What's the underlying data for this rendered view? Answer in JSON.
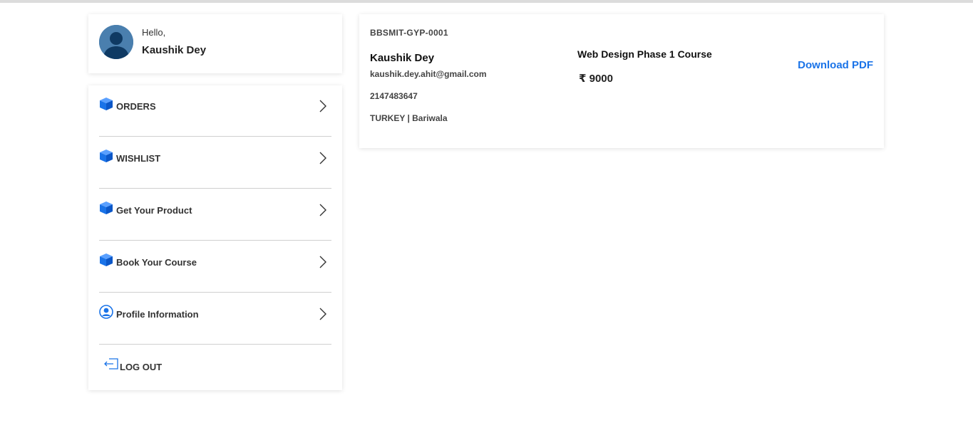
{
  "profile": {
    "greeting": "Hello,",
    "name": "Kaushik Dey"
  },
  "menu": {
    "items": [
      {
        "label": "ORDERS",
        "icon": "box-icon"
      },
      {
        "label": "WISHLIST",
        "icon": "box-icon"
      },
      {
        "label": "Get Your Product",
        "icon": "box-icon"
      },
      {
        "label": "Book Your Course",
        "icon": "box-icon"
      },
      {
        "label": "Profile Information",
        "icon": "user-circle-icon"
      }
    ],
    "logout_label": "LOG OUT"
  },
  "order": {
    "id": "BBSMIT-GYP-0001",
    "customer_name": "Kaushik Dey",
    "email": "kaushik.dey.ahit@gmail.com",
    "phone": "2147483647",
    "location": "TURKEY | Bariwala",
    "course_name": "Web Design Phase 1 Course",
    "price": "₹ 9000",
    "download_label": "Download PDF"
  },
  "colors": {
    "accent": "#1a73e8",
    "avatar_bg": "#4a7fae",
    "divider": "#cfcfcf"
  }
}
